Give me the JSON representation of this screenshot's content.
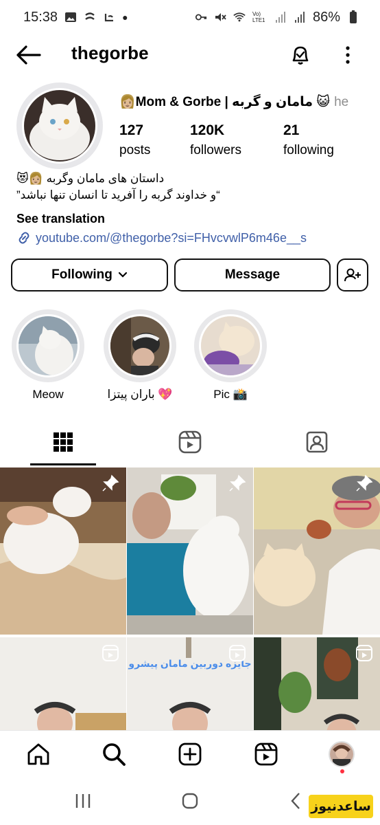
{
  "status_bar": {
    "time": "15:38",
    "battery": "86%",
    "network_label": "Vo) LTE1"
  },
  "header": {
    "username": "thegorbe",
    "back_icon": "arrow-left-icon",
    "bell_icon": "bell-check-icon",
    "more_icon": "more-vertical-icon"
  },
  "profile": {
    "display_name": "👩🏼Mom & Gorbe | مامان و گربه 😺",
    "pronouns": "he",
    "stats": [
      {
        "value": "127",
        "label": "posts"
      },
      {
        "value": "120K",
        "label": "followers"
      },
      {
        "value": "21",
        "label": "following"
      }
    ],
    "bio_line1": "داستان های مامان وگربه 👩🏼😻",
    "bio_line2": "“و خداوند گربه را آفرید تا انسان تنها نباشد”",
    "see_translation": "See translation",
    "link": "youtube.com/@thegorbe?si=FHvcvwlP6m46e__s"
  },
  "actions": {
    "following_label": "Following",
    "message_label": "Message"
  },
  "highlights": [
    {
      "label": "Meow"
    },
    {
      "label": "باران پیتزا 💖"
    },
    {
      "label": "Pic 📸"
    }
  ],
  "tabs": [
    "grid-icon",
    "reels-icon",
    "tagged-icon"
  ],
  "grid": {
    "overlay_text": "جایزه دوربین مامان پیشرو"
  },
  "watermark": "ساعدنیوز",
  "colors": {
    "link": "#3f5fa8",
    "border": "#111111",
    "ring": "#e7e7ea",
    "notification_dot": "#ff3040",
    "watermark_bg": "#f7d21b"
  }
}
